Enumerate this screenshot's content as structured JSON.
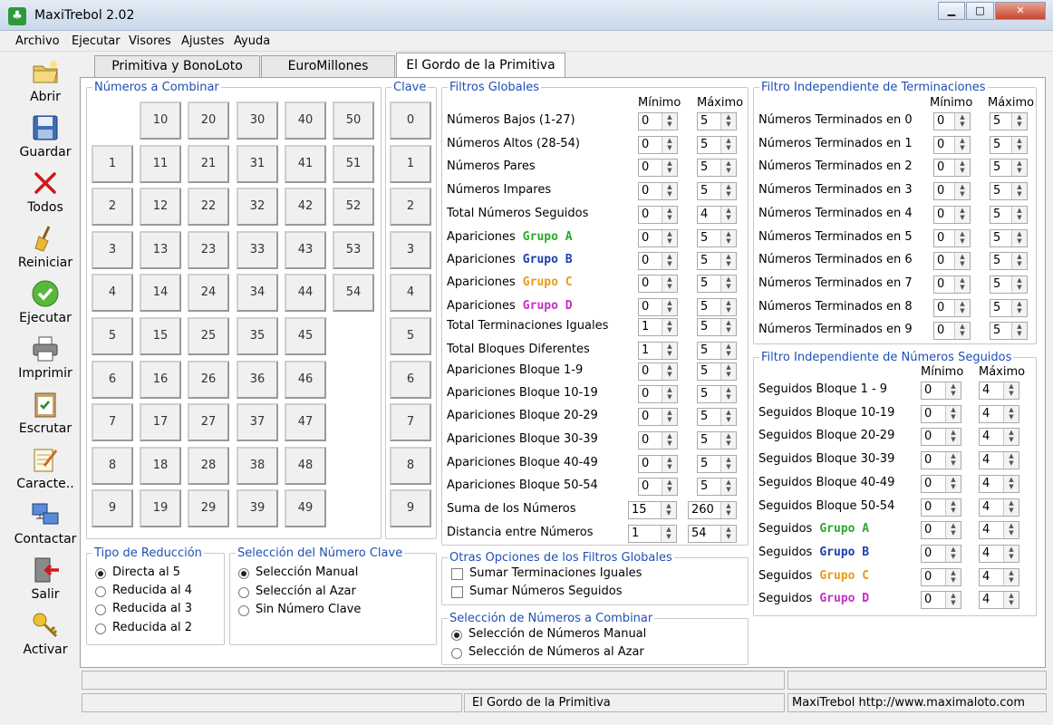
{
  "app": {
    "title": "MaxiTrebol 2.02",
    "icon": "clover-icon"
  },
  "menu": [
    "Archivo",
    "Ejecutar",
    "Visores",
    "Ajustes",
    "Ayuda"
  ],
  "toolbar": [
    {
      "label": "Abrir",
      "icon": "folder-open-icon"
    },
    {
      "label": "Guardar",
      "icon": "floppy-disk-icon"
    },
    {
      "label": "Todos",
      "icon": "red-x-icon"
    },
    {
      "label": "Reiniciar",
      "icon": "broom-icon"
    },
    {
      "label": "Ejecutar",
      "icon": "green-check-icon"
    },
    {
      "label": "Imprimir",
      "icon": "printer-icon"
    },
    {
      "label": "Escrutar",
      "icon": "clipboard-check-icon"
    },
    {
      "label": "Caracte..",
      "icon": "notepad-pen-icon"
    },
    {
      "label": "Contactar",
      "icon": "network-computers-icon"
    },
    {
      "label": "Salir",
      "icon": "exit-door-icon"
    },
    {
      "label": "Activar",
      "icon": "key-icon"
    }
  ],
  "tabs": [
    "Primitiva y BonoLoto",
    "EuroMillones",
    "El Gordo de la Primitiva"
  ],
  "combinar": {
    "legend": "Números a Combinar",
    "columns": [
      [
        "",
        "1",
        "2",
        "3",
        "4",
        "5",
        "6",
        "7",
        "8",
        "9"
      ],
      [
        "10",
        "11",
        "12",
        "13",
        "14",
        "15",
        "16",
        "17",
        "18",
        "19"
      ],
      [
        "20",
        "21",
        "22",
        "23",
        "24",
        "25",
        "26",
        "27",
        "28",
        "29"
      ],
      [
        "30",
        "31",
        "32",
        "33",
        "34",
        "35",
        "36",
        "37",
        "38",
        "39"
      ],
      [
        "40",
        "41",
        "42",
        "43",
        "44",
        "45",
        "46",
        "47",
        "48",
        "49"
      ],
      [
        "50",
        "51",
        "52",
        "53",
        "54",
        "",
        "",
        "",
        "",
        ""
      ]
    ]
  },
  "clave": {
    "legend": "Clave",
    "values": [
      "0",
      "1",
      "2",
      "3",
      "4",
      "5",
      "6",
      "7",
      "8",
      "9"
    ]
  },
  "filtros": {
    "legend": "Filtros Globales",
    "min_header": "Mínimo",
    "max_header": "Máximo",
    "rows": [
      {
        "label": "Números Bajos (1-27)",
        "min": "0",
        "max": "5"
      },
      {
        "label": "Números Altos (28-54)",
        "min": "0",
        "max": "5"
      },
      {
        "label": "Números Pares",
        "min": "0",
        "max": "5"
      },
      {
        "label": "Números Impares",
        "min": "0",
        "max": "5"
      },
      {
        "label": "Total Números Seguidos",
        "min": "0",
        "max": "4"
      },
      {
        "label": "Apariciones",
        "group": "Grupo A",
        "gcolor": "#2ea62e",
        "min": "0",
        "max": "5"
      },
      {
        "label": "Apariciones",
        "group": "Grupo B",
        "gcolor": "#1c3fa8",
        "min": "0",
        "max": "5"
      },
      {
        "label": "Apariciones",
        "group": "Grupo C",
        "gcolor": "#e89a1a",
        "min": "0",
        "max": "5"
      },
      {
        "label": "Apariciones",
        "group": "Grupo D",
        "gcolor": "#c42fc4",
        "min": "0",
        "max": "5"
      },
      {
        "label": "Total Terminaciones Iguales",
        "min": "1",
        "max": "5"
      },
      {
        "label": "Total Bloques Diferentes",
        "min": "1",
        "max": "5"
      },
      {
        "label": "Apariciones Bloque 1-9",
        "min": "0",
        "max": "5"
      },
      {
        "label": "Apariciones Bloque 10-19",
        "min": "0",
        "max": "5"
      },
      {
        "label": "Apariciones Bloque 20-29",
        "min": "0",
        "max": "5"
      },
      {
        "label": "Apariciones Bloque 30-39",
        "min": "0",
        "max": "5"
      },
      {
        "label": "Apariciones Bloque 40-49",
        "min": "0",
        "max": "5"
      },
      {
        "label": "Apariciones Bloque 50-54",
        "min": "0",
        "max": "5"
      },
      {
        "label": "Suma de los Números",
        "min": "15",
        "max": "260"
      },
      {
        "label": "Distancia entre Números",
        "min": "1",
        "max": "54"
      }
    ]
  },
  "terminaciones": {
    "legend": "Filtro Independiente de Terminaciones",
    "min_header": "Mínimo",
    "max_header": "Máximo",
    "rows": [
      {
        "label": "Números Terminados en 0",
        "min": "0",
        "max": "5"
      },
      {
        "label": "Números Terminados en 1",
        "min": "0",
        "max": "5"
      },
      {
        "label": "Números Terminados en 2",
        "min": "0",
        "max": "5"
      },
      {
        "label": "Números Terminados en 3",
        "min": "0",
        "max": "5"
      },
      {
        "label": "Números Terminados en 4",
        "min": "0",
        "max": "5"
      },
      {
        "label": "Números Terminados en 5",
        "min": "0",
        "max": "5"
      },
      {
        "label": "Números Terminados en 6",
        "min": "0",
        "max": "5"
      },
      {
        "label": "Números Terminados en 7",
        "min": "0",
        "max": "5"
      },
      {
        "label": "Números Terminados en 8",
        "min": "0",
        "max": "5"
      },
      {
        "label": "Números Terminados en 9",
        "min": "0",
        "max": "5"
      }
    ]
  },
  "seguidos": {
    "legend": "Filtro Independiente de Números Seguidos",
    "min_header": "Mínimo",
    "max_header": "Máximo",
    "rows": [
      {
        "label": "Seguidos Bloque  1 - 9",
        "min": "0",
        "max": "4"
      },
      {
        "label": "Seguidos Bloque 10-19",
        "min": "0",
        "max": "4"
      },
      {
        "label": "Seguidos Bloque 20-29",
        "min": "0",
        "max": "4"
      },
      {
        "label": "Seguidos Bloque 30-39",
        "min": "0",
        "max": "4"
      },
      {
        "label": "Seguidos Bloque 40-49",
        "min": "0",
        "max": "4"
      },
      {
        "label": "Seguidos Bloque 50-54",
        "min": "0",
        "max": "4"
      },
      {
        "label": "Seguidos",
        "group": "Grupo A",
        "gcolor": "#2ea62e",
        "min": "0",
        "max": "4"
      },
      {
        "label": "Seguidos",
        "group": "Grupo B",
        "gcolor": "#1c3fa8",
        "min": "0",
        "max": "4"
      },
      {
        "label": "Seguidos",
        "group": "Grupo C",
        "gcolor": "#e89a1a",
        "min": "0",
        "max": "4"
      },
      {
        "label": "Seguidos",
        "group": "Grupo D",
        "gcolor": "#c42fc4",
        "min": "0",
        "max": "4"
      }
    ]
  },
  "reduccion": {
    "legend": "Tipo de Reducción",
    "options": [
      "Directa al 5",
      "Reducida al 4",
      "Reducida al 3",
      "Reducida al 2"
    ],
    "selected": 0
  },
  "seleccion_clave": {
    "legend": "Selección del Número Clave",
    "options": [
      "Selección Manual",
      "Selección al Azar",
      "Sin Número Clave"
    ],
    "selected": 0
  },
  "otras": {
    "legend": "Otras Opciones de los Filtros Globales",
    "options": [
      "Sumar Terminaciones Iguales",
      "Sumar Números Seguidos"
    ]
  },
  "seleccion_numeros": {
    "legend": "Selección de Números a Combinar",
    "options": [
      "Selección de Números Manual",
      "Selección de Números al Azar"
    ],
    "selected": 0
  },
  "status": {
    "game": "El Gordo de la Primitiva",
    "site": "MaxiTrebol http://www.maximaloto.com"
  }
}
